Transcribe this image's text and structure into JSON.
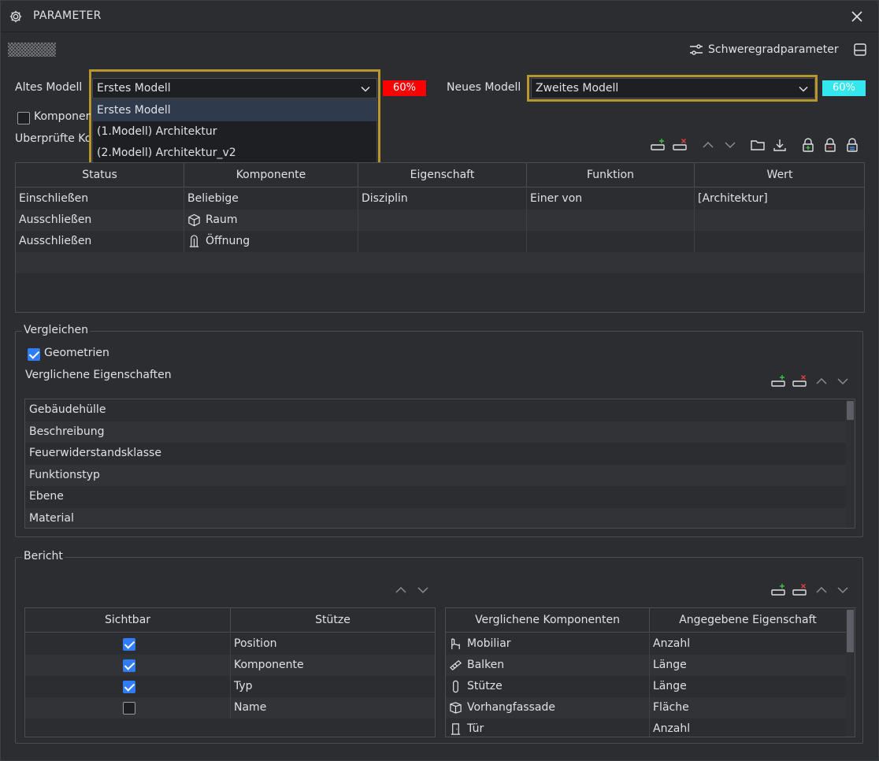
{
  "window": {
    "title": "PARAMETER"
  },
  "severity_button": {
    "label": "Schweregradparameter"
  },
  "old_model": {
    "label": "Altes Modell",
    "selected": "Erstes Modell",
    "percent": "60%",
    "percent_color": "#ff0000",
    "options": [
      "Erstes Modell",
      "(1.Modell) Architektur",
      "(2.Modell) Architektur_v2"
    ]
  },
  "new_model": {
    "label": "Neues Modell",
    "selected": "Zweites Modell",
    "percent": "60%",
    "percent_color": "#33e6f0"
  },
  "components_checkbox": {
    "label": "Komponenten",
    "checked": false
  },
  "checked_components_label": "Überprüfte Komponenten",
  "filter_table": {
    "headers": [
      "Status",
      "Komponente",
      "Eigenschaft",
      "Funktion",
      "Wert"
    ],
    "rows": [
      {
        "status": "Einschließen",
        "component": "Beliebige",
        "icon": "",
        "property": "Disziplin",
        "function": "Einer von",
        "value": "[Architektur]"
      },
      {
        "status": "Ausschließen",
        "component": "Raum",
        "icon": "cube-icon",
        "property": "",
        "function": "",
        "value": ""
      },
      {
        "status": "Ausschließen",
        "component": "Öffnung",
        "icon": "opening-icon",
        "property": "",
        "function": "",
        "value": ""
      }
    ]
  },
  "compare": {
    "legend": "Vergleichen",
    "geometry_label": "Geometrien",
    "geometry_checked": true,
    "properties_label": "Verglichene Eigenschaften",
    "properties": [
      "Gebäudehülle",
      "Beschreibung",
      "Feuerwiderstandsklasse",
      "Funktionstyp",
      "Ebene",
      "Material"
    ]
  },
  "report": {
    "legend": "Bericht",
    "left_table": {
      "headers": [
        "Sichtbar",
        "Stütze"
      ],
      "rows": [
        {
          "visible": true,
          "name": "Position"
        },
        {
          "visible": true,
          "name": "Komponente"
        },
        {
          "visible": true,
          "name": "Typ"
        },
        {
          "visible": false,
          "name": "Name"
        }
      ]
    },
    "right_table": {
      "headers": [
        "Verglichene Komponenten",
        "Angegebene Eigenschaft"
      ],
      "rows": [
        {
          "component": "Mobiliar",
          "icon": "chair-icon",
          "property": "Anzahl"
        },
        {
          "component": "Balken",
          "icon": "beam-icon",
          "property": "Länge"
        },
        {
          "component": "Stütze",
          "icon": "column-icon",
          "property": "Länge"
        },
        {
          "component": "Vorhangfassade",
          "icon": "curtain-wall-icon",
          "property": "Fläche"
        },
        {
          "component": "Tür",
          "icon": "door-icon",
          "property": "Anzahl"
        }
      ]
    }
  }
}
